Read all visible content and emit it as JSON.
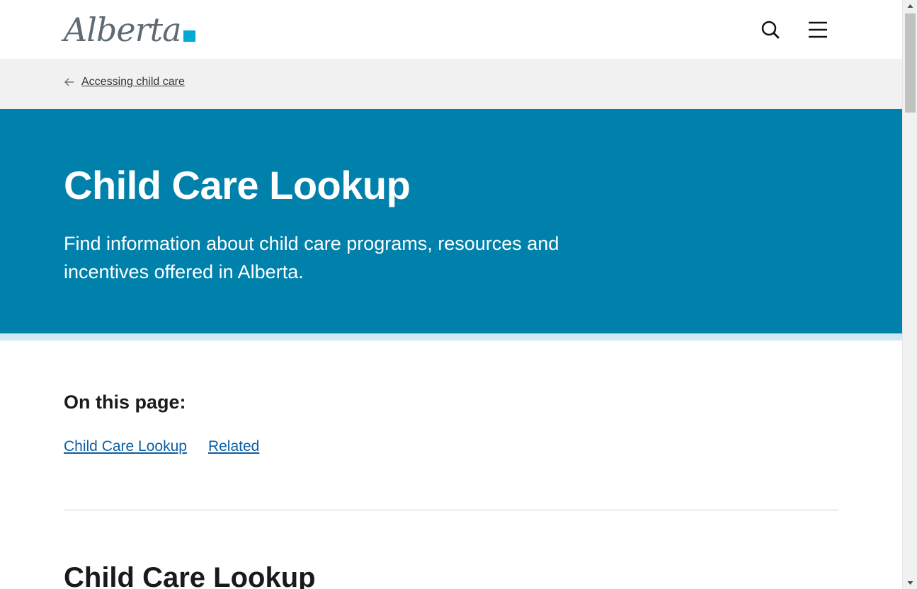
{
  "header": {
    "logo_text": "Alberta",
    "search_icon": "search-icon",
    "menu_icon": "hamburger-menu-icon"
  },
  "breadcrumb": {
    "back_icon": "arrow-left-icon",
    "link_label": "Accessing child care"
  },
  "hero": {
    "title": "Child Care Lookup",
    "description": "Find information about child care programs, resources and incentives offered in Alberta."
  },
  "on_this_page": {
    "heading": "On this page:",
    "links": [
      "Child Care Lookup",
      "Related"
    ]
  },
  "section": {
    "title": "Child Care Lookup"
  },
  "colors": {
    "hero_bg": "#0081ab",
    "hero_strip": "#cfeaf4",
    "breadcrumb_bg": "#f1f1f1",
    "link": "#0b5fa5",
    "logo_mark": "#00aad2"
  }
}
